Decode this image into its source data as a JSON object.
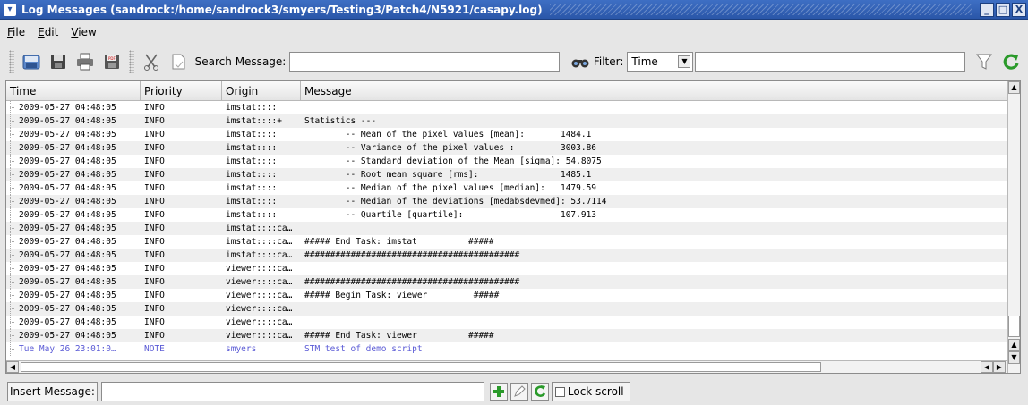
{
  "window": {
    "title": "Log Messages (sandrock:/home/sandrock3/smyers/Testing3/Patch4/N5921/casapy.log)",
    "buttons": [
      "_",
      "□",
      "X"
    ]
  },
  "menu": [
    "File",
    "Edit",
    "View"
  ],
  "toolbar": {
    "search_label": "Search Message:",
    "search_value": "",
    "filter_label": "Filter:",
    "filter_field": "Time",
    "filter_value": ""
  },
  "table": {
    "columns": [
      "Time",
      "Priority",
      "Origin",
      "Message"
    ],
    "rows": [
      {
        "time": "2009-05-27 04:48:05",
        "priority": "INFO",
        "origin": "imstat::::",
        "message": ""
      },
      {
        "time": "2009-05-27 04:48:05",
        "priority": "INFO",
        "origin": "imstat::::+",
        "message": "Statistics ---"
      },
      {
        "time": "2009-05-27 04:48:05",
        "priority": "INFO",
        "origin": "imstat::::",
        "message": "        -- Mean of the pixel values [mean]:       1484.1"
      },
      {
        "time": "2009-05-27 04:48:05",
        "priority": "INFO",
        "origin": "imstat::::",
        "message": "        -- Variance of the pixel values :         3003.86"
      },
      {
        "time": "2009-05-27 04:48:05",
        "priority": "INFO",
        "origin": "imstat::::",
        "message": "        -- Standard deviation of the Mean [sigma]: 54.8075"
      },
      {
        "time": "2009-05-27 04:48:05",
        "priority": "INFO",
        "origin": "imstat::::",
        "message": "        -- Root mean square [rms]:                1485.1"
      },
      {
        "time": "2009-05-27 04:48:05",
        "priority": "INFO",
        "origin": "imstat::::",
        "message": "        -- Median of the pixel values [median]:   1479.59"
      },
      {
        "time": "2009-05-27 04:48:05",
        "priority": "INFO",
        "origin": "imstat::::",
        "message": "        -- Median of the deviations [medabsdevmed]: 53.7114"
      },
      {
        "time": "2009-05-27 04:48:05",
        "priority": "INFO",
        "origin": "imstat::::",
        "message": "        -- Quartile [quartile]:                   107.913"
      },
      {
        "time": "2009-05-27 04:48:05",
        "priority": "INFO",
        "origin": "imstat::::ca…",
        "message": ""
      },
      {
        "time": "2009-05-27 04:48:05",
        "priority": "INFO",
        "origin": "imstat::::ca…",
        "message": "##### End Task: imstat          #####"
      },
      {
        "time": "2009-05-27 04:48:05",
        "priority": "INFO",
        "origin": "imstat::::ca…",
        "message": "##########################################"
      },
      {
        "time": "2009-05-27 04:48:05",
        "priority": "INFO",
        "origin": "viewer::::ca…",
        "message": ""
      },
      {
        "time": "2009-05-27 04:48:05",
        "priority": "INFO",
        "origin": "viewer::::ca…",
        "message": "##########################################"
      },
      {
        "time": "2009-05-27 04:48:05",
        "priority": "INFO",
        "origin": "viewer::::ca…",
        "message": "##### Begin Task: viewer         #####"
      },
      {
        "time": "2009-05-27 04:48:05",
        "priority": "INFO",
        "origin": "viewer::::ca…",
        "message": ""
      },
      {
        "time": "2009-05-27 04:48:05",
        "priority": "INFO",
        "origin": "viewer::::ca…",
        "message": ""
      },
      {
        "time": "2009-05-27 04:48:05",
        "priority": "INFO",
        "origin": "viewer::::ca…",
        "message": "##### End Task: viewer          #####"
      },
      {
        "time": "Tue May 26 23:01:0…",
        "priority": "NOTE",
        "origin": "smyers",
        "message": "STM test of demo script"
      }
    ]
  },
  "bottom": {
    "insert_label": "Insert Message:",
    "insert_value": "",
    "lock_label": "Lock scroll",
    "lock_checked": false
  },
  "colors": {
    "titlebar": "#2a56a8",
    "note_text": "#5b5bd6",
    "refresh_green": "#2a9a2a"
  }
}
